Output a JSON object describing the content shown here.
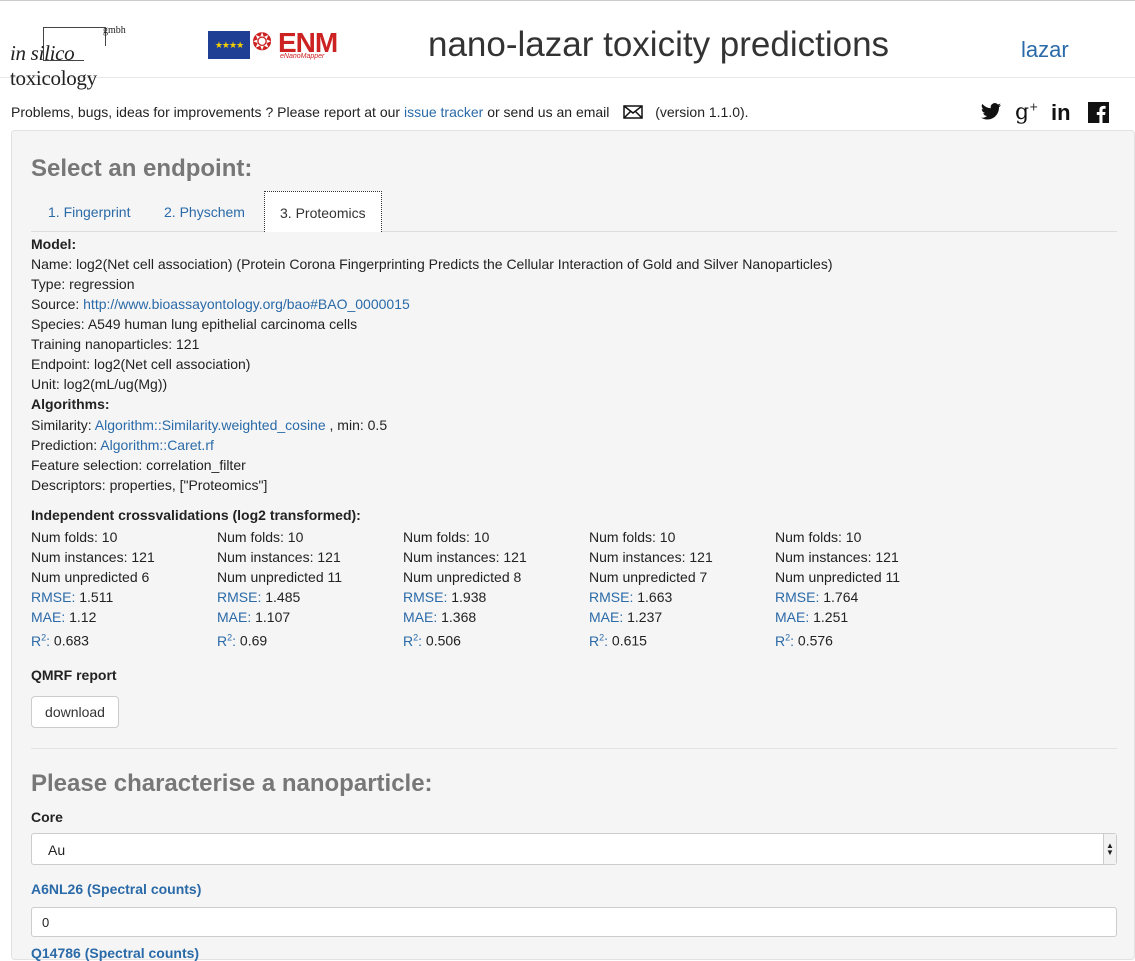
{
  "header": {
    "logo_ist": {
      "gmbh": "gmbh",
      "prefix": "in silico",
      "suffix": "toxicology"
    },
    "logo_enm": {
      "main": "ENM",
      "sub": "eNanoMapper"
    },
    "title": "nano-lazar toxicity predictions",
    "lazar_link": "lazar"
  },
  "notice": {
    "before": "Problems, bugs, ideas for improvements ? Please report at our",
    "issue_tracker": "issue tracker",
    "middle": "or send us an email",
    "version": "(version 1.1.0)."
  },
  "social": [
    "twitter-icon",
    "google-plus-icon",
    "linkedin-icon",
    "facebook-icon"
  ],
  "endpoint": {
    "heading": "Select an endpoint:",
    "tabs": [
      {
        "label": "1. Fingerprint"
      },
      {
        "label": "2. Physchem"
      },
      {
        "label": "3. Proteomics",
        "active": true
      }
    ]
  },
  "model": {
    "heading": "Model:",
    "name": "Name: log2(Net cell association) (Protein Corona Fingerprinting Predicts the Cellular Interaction of Gold and Silver Nanoparticles)",
    "type": "Type: regression",
    "source_label": "Source:",
    "source_url": "http://www.bioassayontology.org/bao#BAO_0000015",
    "species": "Species: A549 human lung epithelial carcinoma cells",
    "training": "Training nanoparticles: 121",
    "endpoint": "Endpoint: log2(Net cell association)",
    "unit": "Unit: log2(mL/ug(Mg))"
  },
  "algorithms": {
    "heading": "Algorithms:",
    "similarity_label": "Similarity:",
    "similarity_link": "Algorithm::Similarity.weighted_cosine",
    "similarity_suffix": ", min: 0.5",
    "prediction_label": "Prediction:",
    "prediction_link": "Algorithm::Caret.rf",
    "feature_selection": "Feature selection: correlation_filter",
    "descriptors": "Descriptors: properties, [\"Proteomics\"]"
  },
  "crossvalidation": {
    "heading": "Independent crossvalidations (log2 transformed):",
    "rmse_label": "RMSE:",
    "mae_label": "MAE:",
    "r2_label": "R",
    "r2_sup": "2",
    "r2_colon": ":",
    "columns": [
      {
        "folds": "Num folds: 10",
        "instances": "Num instances: 121",
        "unpredicted": "Num unpredicted 6",
        "rmse": "1.511",
        "mae": "1.12",
        "r2": "0.683"
      },
      {
        "folds": "Num folds: 10",
        "instances": "Num instances: 121",
        "unpredicted": "Num unpredicted 11",
        "rmse": "1.485",
        "mae": "1.107",
        "r2": "0.69"
      },
      {
        "folds": "Num folds: 10",
        "instances": "Num instances: 121",
        "unpredicted": "Num unpredicted 8",
        "rmse": "1.938",
        "mae": "1.368",
        "r2": "0.506"
      },
      {
        "folds": "Num folds: 10",
        "instances": "Num instances: 121",
        "unpredicted": "Num unpredicted 7",
        "rmse": "1.663",
        "mae": "1.237",
        "r2": "0.615"
      },
      {
        "folds": "Num folds: 10",
        "instances": "Num instances: 121",
        "unpredicted": "Num unpredicted 11",
        "rmse": "1.764",
        "mae": "1.251",
        "r2": "0.576"
      }
    ]
  },
  "qmrf": {
    "heading": "QMRF report",
    "button": "download"
  },
  "characterise": {
    "heading": "Please characterise a nanoparticle:",
    "core_label": "Core",
    "core_value": "Au",
    "a6nl26_label": "A6NL26 (Spectral counts)",
    "a6nl26_value": "0",
    "next_label": "Q14786 (Spectral counts)"
  },
  "colors": {
    "link": "#2a6aa8",
    "heading_gray": "#777777",
    "panel_bg": "#f5f5f5"
  }
}
